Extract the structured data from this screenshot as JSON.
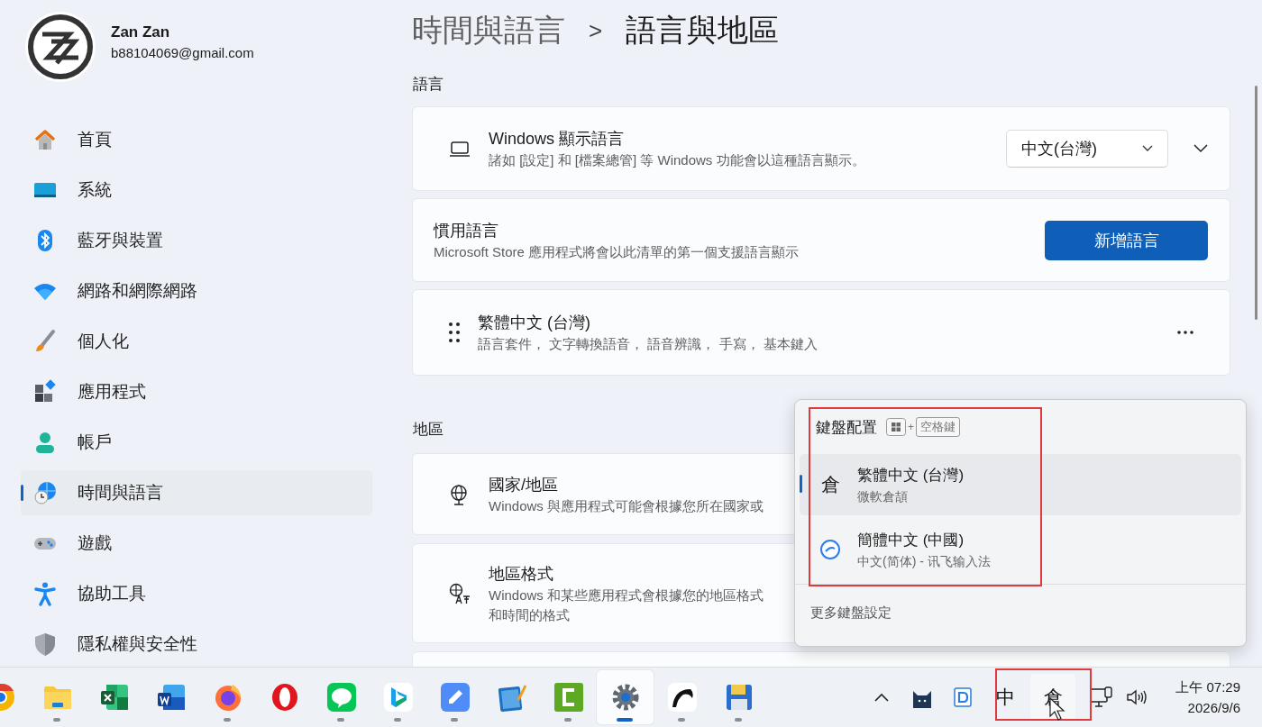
{
  "account": {
    "name": "Zan Zan",
    "email": "b88104069@gmail.com"
  },
  "nav": [
    {
      "label": "首頁",
      "kind": "home",
      "selected": false
    },
    {
      "label": "系統",
      "kind": "system",
      "selected": false
    },
    {
      "label": "藍牙與裝置",
      "kind": "bluetooth",
      "selected": false
    },
    {
      "label": "網路和網際網路",
      "kind": "network",
      "selected": false
    },
    {
      "label": "個人化",
      "kind": "personalize",
      "selected": false
    },
    {
      "label": "應用程式",
      "kind": "apps",
      "selected": false
    },
    {
      "label": "帳戶",
      "kind": "accounts",
      "selected": false
    },
    {
      "label": "時間與語言",
      "kind": "time",
      "selected": true
    },
    {
      "label": "遊戲",
      "kind": "gaming",
      "selected": false
    },
    {
      "label": "協助工具",
      "kind": "accessibility",
      "selected": false
    },
    {
      "label": "隱私權與安全性",
      "kind": "privacy",
      "selected": false
    }
  ],
  "breadcrumb": {
    "parent": "時間與語言",
    "separator": ">",
    "current": "語言與地區"
  },
  "language_section": {
    "heading": "語言",
    "display_language": {
      "title": "Windows 顯示語言",
      "description": "諸如 [設定] 和 [檔案總管] 等 Windows 功能會以這種語言顯示。",
      "value": "中文(台灣)"
    },
    "preferred": {
      "title": "慣用語言",
      "description": "Microsoft Store 應用程式將會以此清單的第一個支援語言顯示",
      "button": "新增語言"
    },
    "languages": [
      {
        "name": "繁體中文 (台灣)",
        "features": "語言套件， 文字轉換語音， 語音辨識， 手寫， 基本鍵入"
      }
    ]
  },
  "region_section": {
    "heading": "地區",
    "cards": [
      {
        "kind": "country",
        "title": "國家/地區",
        "description_lines": [
          "Windows 與應用程式可能會根據您所在國家或"
        ]
      },
      {
        "kind": "format",
        "title": "地區格式",
        "description_lines": [
          "Windows 和某些應用程式會根據您的地區格式",
          "和時間的格式"
        ]
      }
    ]
  },
  "keyboard_popup": {
    "title": "鍵盤配置",
    "shortcut": {
      "plus": "+",
      "key": "空格鍵"
    },
    "layouts": [
      {
        "kind": "glyph",
        "glyph": "倉",
        "name": "繁體中文 (台灣)",
        "method": "微軟倉頡",
        "selected": true
      },
      {
        "kind": "logo",
        "name": "簡體中文 (中國)",
        "method": "中文(简体) - 讯飞输入法",
        "selected": false
      }
    ],
    "more": "更多鍵盤設定"
  },
  "taskbar": {
    "apps": [
      {
        "kind": "chrome",
        "running": false,
        "active": false
      },
      {
        "kind": "folder",
        "running": true,
        "active": false
      },
      {
        "kind": "spreadsheet",
        "running": false,
        "active": false
      },
      {
        "kind": "document",
        "running": false,
        "active": false
      },
      {
        "kind": "firefox",
        "running": true,
        "active": false
      },
      {
        "kind": "ring",
        "running": false,
        "active": false
      },
      {
        "kind": "chat",
        "running": true,
        "active": false
      },
      {
        "kind": "wave",
        "running": true,
        "active": false
      },
      {
        "kind": "pen",
        "running": true,
        "active": false
      },
      {
        "kind": "notepad",
        "running": false,
        "active": false
      },
      {
        "kind": "bracket",
        "running": true,
        "active": false
      },
      {
        "kind": "gear",
        "running": true,
        "active": true
      },
      {
        "kind": "swoosh",
        "running": true,
        "active": false
      },
      {
        "kind": "floppy",
        "running": true,
        "active": false
      }
    ],
    "ime_mode": "中",
    "ime_layout": "倉",
    "time": "上午 07:29",
    "date": "2026/9/6"
  }
}
